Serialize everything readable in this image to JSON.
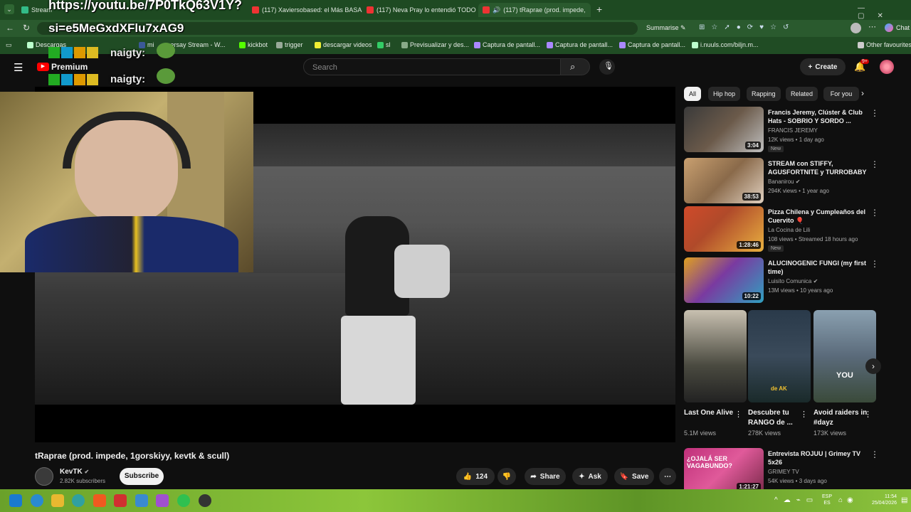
{
  "browser": {
    "tabs": [
      {
        "label": "Stream"
      },
      {
        "label": "(117) Xaviersobased: el Más BASAD"
      },
      {
        "label": "(117) Neva Pray lo entendió TODO"
      },
      {
        "label": "(117) tRaprae (prod. impede,"
      }
    ],
    "bookmarks": [
      "Descargas",
      "mi",
      "seersay Stream - W...",
      "kickbot",
      "trigger",
      "descargar videos",
      "sl",
      "Previsualizar y des...",
      "Captura de pantall...",
      "Captura de pantall...",
      "Captura de pantall...",
      "i.nuuls.com/biljn.m...",
      "Other favourites"
    ],
    "summarise_label": "Summarise",
    "chat_label": "Chat"
  },
  "overlay": {
    "url_line1": "https://youtu.be/7P0TkQ63V1Y?",
    "url_line2": "si=e5MeGxdXFlu7xAG9",
    "chat_name1": "naigty:",
    "chat_name2": "naigty:"
  },
  "youtube": {
    "logo_label": "Premium",
    "search_placeholder": "Search",
    "create_label": "Create",
    "notif_count": "9+"
  },
  "video": {
    "title": "tRaprae (prod. impede, 1gorskiyy, kevtk & scull)",
    "channel": "KevTK",
    "subscribers": "2.82K subscribers",
    "subscribe_label": "Subscribe",
    "likes": "124",
    "share_label": "Share",
    "ask_label": "Ask",
    "save_label": "Save"
  },
  "chips": [
    "All",
    "Hip hop",
    "Rapping",
    "Related",
    "For you"
  ],
  "recommendations": [
    {
      "title": "Francis Jeremy, Clúster & Club Hats - SOBRIO Y SORDO ...",
      "channel": "FRANCIS JEREMY",
      "meta": "12K views • 1 day ago",
      "duration": "3:04",
      "badge": "New",
      "color": "#6b5a4a"
    },
    {
      "title": "STREAM con STIFFY, AGUSFORTNITE y TURROBABY",
      "channel": "Bananirou",
      "meta": "294K views • 1 year ago",
      "duration": "38:53",
      "badge": "",
      "color": "#8a6a4a"
    },
    {
      "title": "Pizza Chilena y Cumpleaños del Cuervito 🎈",
      "channel": "La Cocina de Lili",
      "meta": "108 views • Streamed 18 hours ago",
      "duration": "1:28:46",
      "badge": "New",
      "color": "#b04a2a"
    },
    {
      "title": "ALUCINOGENIC FUNGI (my first time)",
      "channel": "Luisito Comunica",
      "meta": "13M views • 10 years ago",
      "duration": "10:22",
      "badge": "",
      "color": "#7a3aa0"
    }
  ],
  "shorts": [
    {
      "title": "Last One Alive",
      "views": "5.1M views",
      "overlay": "",
      "color": "#4a4a40"
    },
    {
      "title": "Descubre tu RANGO de ...",
      "views": "278K views",
      "overlay": "de AK",
      "color": "#3a4a5a"
    },
    {
      "title": "Avoid raiders in #dayz",
      "views": "173K views",
      "overlay": "YOU",
      "color": "#5a6a7a"
    }
  ],
  "bottom_rec": {
    "title": "Entrevista ROJUU | Grimey TV 5x26",
    "channel": "GRIMEY TV",
    "meta": "54K views • 3 days ago",
    "duration": "1:21:27",
    "overlay": "¿OJALÁ SER VAGABUNDO?"
  },
  "taskbar": {
    "lang1": "ESP",
    "lang2": "ES",
    "time": "11:54",
    "date": "25/04/2026"
  }
}
